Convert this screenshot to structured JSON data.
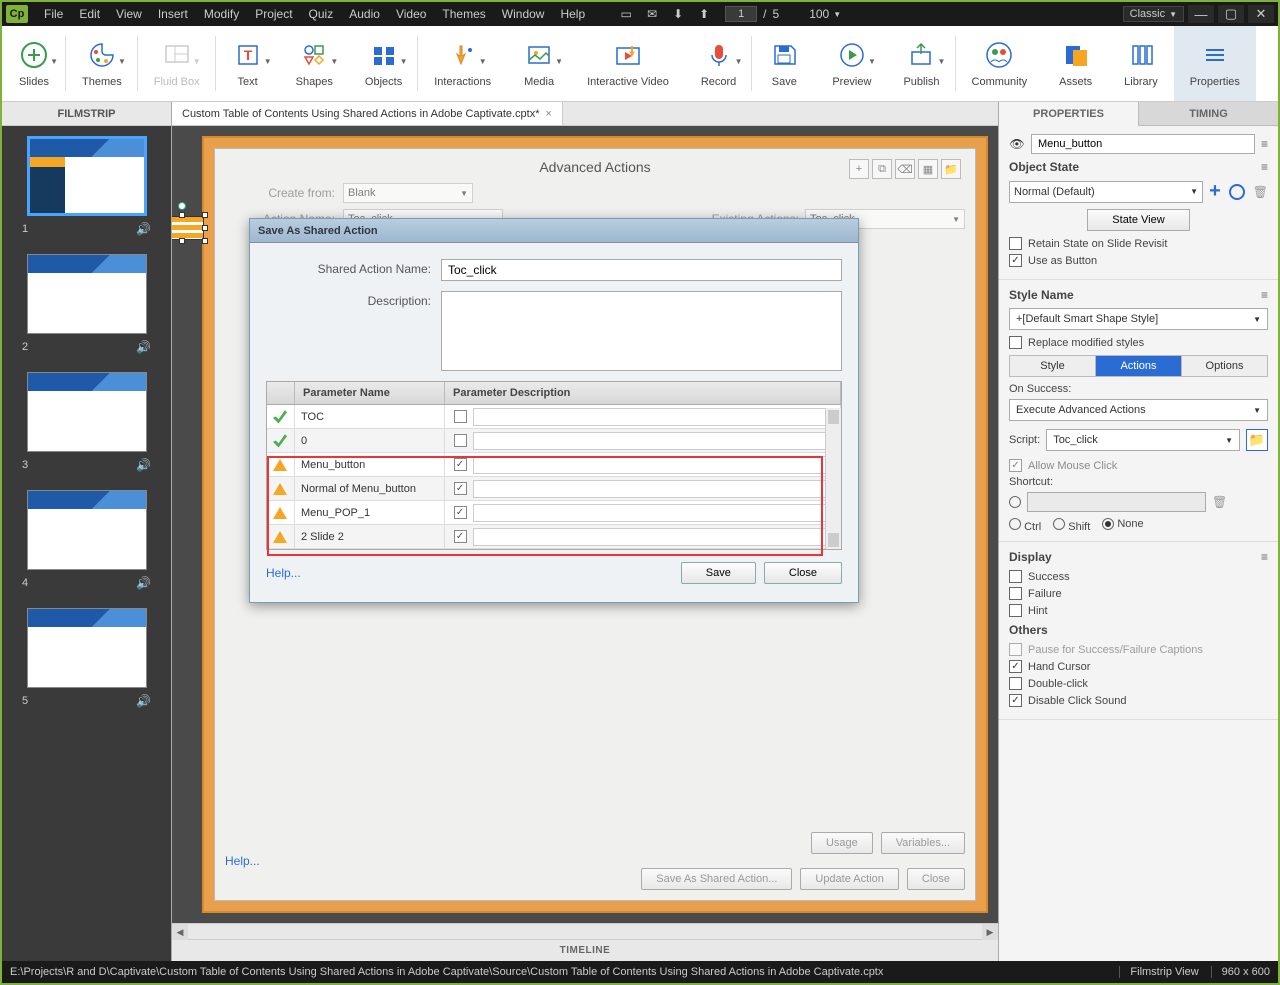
{
  "titlebar": {
    "menus": [
      "File",
      "Edit",
      "View",
      "Insert",
      "Modify",
      "Project",
      "Quiz",
      "Audio",
      "Video",
      "Themes",
      "Window",
      "Help"
    ],
    "current_page": "1",
    "total_pages": "5",
    "zoom": "100",
    "layout": "Classic"
  },
  "ribbon": {
    "items": [
      "Slides",
      "Themes",
      "Fluid Box",
      "Text",
      "Shapes",
      "Objects",
      "Interactions",
      "Media",
      "Interactive Video",
      "Record",
      "Save",
      "Preview",
      "Publish",
      "Community",
      "Assets",
      "Library",
      "Properties"
    ]
  },
  "filmstrip": {
    "header": "FILMSTRIP",
    "slides": [
      "1",
      "2",
      "3",
      "4",
      "5"
    ]
  },
  "document": {
    "tab_name": "Custom Table of Contents Using Shared Actions in Adobe Captivate.cptx*"
  },
  "advanced_actions": {
    "title": "Advanced Actions",
    "create_from_label": "Create from:",
    "create_from_value": "Blank",
    "action_name_label": "Action Name:",
    "action_name_value": "Toc_click",
    "existing_label": "Existing Actions:",
    "existing_value": "Toc_click",
    "help": "Help...",
    "usage_btn": "Usage",
    "variables_btn": "Variables...",
    "save_as_shared_btn": "Save As Shared Action...",
    "update_btn": "Update Action",
    "close_btn": "Close"
  },
  "shared_dialog": {
    "title": "Save As Shared Action",
    "name_label": "Shared Action Name:",
    "name_value": "Toc_click",
    "desc_label": "Description:",
    "param_name_header": "Parameter Name",
    "param_desc_header": "Parameter Description",
    "rows": [
      {
        "name": "TOC",
        "check": true,
        "cb": false
      },
      {
        "name": "0",
        "check": true,
        "cb": false
      },
      {
        "name": "Menu_button",
        "check": false,
        "cb": true
      },
      {
        "name": "Normal of Menu_button",
        "check": false,
        "cb": true
      },
      {
        "name": "Menu_POP_1",
        "check": false,
        "cb": true
      },
      {
        "name": "2 Slide 2",
        "check": false,
        "cb": true
      }
    ],
    "help": "Help...",
    "save_btn": "Save",
    "close_btn": "Close"
  },
  "timeline_label": "TIMELINE",
  "properties": {
    "tabs": {
      "props": "PROPERTIES",
      "timing": "TIMING"
    },
    "object_name": "Menu_button",
    "object_state_label": "Object State",
    "state_value": "Normal (Default)",
    "state_view_btn": "State View",
    "retain_state": "Retain State on Slide Revisit",
    "use_as_button": "Use as Button",
    "style_name_label": "Style Name",
    "style_value": "+[Default Smart Shape Style]",
    "replace_styles": "Replace modified styles",
    "sub_tabs": {
      "style": "Style",
      "actions": "Actions",
      "options": "Options"
    },
    "on_success_label": "On Success:",
    "on_success_value": "Execute Advanced Actions",
    "script_label": "Script:",
    "script_value": "Toc_click",
    "allow_mouse": "Allow Mouse Click",
    "shortcut_label": "Shortcut:",
    "radio_ctrl": "Ctrl",
    "radio_shift": "Shift",
    "radio_none": "None",
    "display_label": "Display",
    "success_cb": "Success",
    "failure_cb": "Failure",
    "hint_cb": "Hint",
    "others_label": "Others",
    "pause_caption": "Pause for Success/Failure Captions",
    "hand_cursor": "Hand Cursor",
    "double_click": "Double-click",
    "disable_sound": "Disable Click Sound"
  },
  "statusbar": {
    "path": "E:\\Projects\\R and D\\Captivate\\Custom Table of Contents Using Shared Actions in Adobe Captivate\\Source\\Custom Table of Contents Using Shared Actions in Adobe Captivate.cptx",
    "view": "Filmstrip View",
    "size": "960 x 600"
  }
}
